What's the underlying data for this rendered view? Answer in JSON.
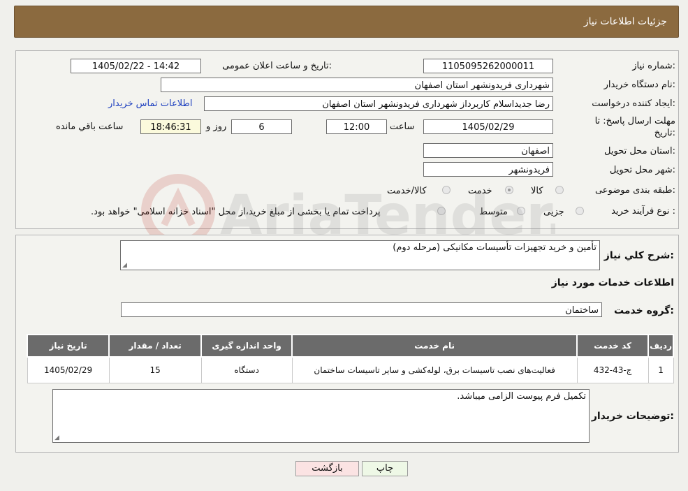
{
  "header": {
    "title": "جزئیات اطلاعات نیاز"
  },
  "fields": {
    "need_number": {
      "label": "شماره نیاز:",
      "value": "1105095262000011"
    },
    "announce": {
      "label": "تاریخ و ساعت اعلان عمومی:",
      "value": "1405/02/22 - 14:42"
    },
    "buyer_org": {
      "label": "نام دستگاه خریدار:",
      "value": "شهرداری فریدونشهر استان اصفهان"
    },
    "requester": {
      "label": "ایجاد کننده درخواست:",
      "value": "رضا جدیداسلام کاربرداز شهرداری فریدونشهر استان اصفهان",
      "contact_link": "اطلاعات تماس خریدار"
    },
    "deadline": {
      "label_line1": "مهلت ارسال پاسخ: تا",
      "label_line2": "تاریخ:",
      "date": "1405/02/29",
      "time_label": "ساعت",
      "time": "12:00",
      "days": "6",
      "days_label": "روز و",
      "remaining": "18:46:31",
      "remaining_label": "ساعت باقي مانده"
    },
    "province": {
      "label": "استان محل تحویل:",
      "value": "اصفهان"
    },
    "city": {
      "label": "شهر محل تحویل:",
      "value": "فریدونشهر"
    },
    "category": {
      "label": "طبقه بندی موضوعی:",
      "options": [
        "کالا",
        "خدمت",
        "کالا/خدمت"
      ],
      "selected": "خدمت"
    },
    "process": {
      "label": "نوع فرآیند خرید :",
      "options": [
        "جزیی",
        "متوسط"
      ],
      "note": "پرداخت تمام یا بخشی از مبلغ خرید،از محل \"اسناد خزانه اسلامی\" خواهد بود."
    }
  },
  "summary": {
    "label": "شرح کلي نیاز:",
    "value": "تأمین و خرید تجهیزات تأسیسات مکانیکی (مرحله دوم)"
  },
  "services": {
    "section_title": "اطلاعات خدمات مورد نیاز",
    "group_label": "گروه خدمت:",
    "group_value": "ساختمان",
    "columns": [
      "ردیف",
      "کد خدمت",
      "نام خدمت",
      "واحد اندازه گیری",
      "تعداد / مقدار",
      "تاریخ نیاز"
    ],
    "rows": [
      [
        "1",
        "ج-43-432",
        "فعالیت‌های نصب تاسیسات برق، لوله‌کشی و سایر تاسیسات ساختمان",
        "دستگاه",
        "15",
        "1405/02/29"
      ]
    ]
  },
  "buyer_notes": {
    "label": "توضیحات خریدار:",
    "value": "تکمیل فرم پیوست الزامی میباشد."
  },
  "buttons": {
    "print": "چاپ",
    "back": "بازگشت"
  },
  "watermark": {
    "text": "AriaTender.neT"
  },
  "colors": {
    "header_bg": "#8b6a3f",
    "table_header_bg": "#6b6b6b",
    "link": "#1d3fbf",
    "back_button_bg": "#fbe3e3",
    "print_button_bg": "#eef8e6"
  }
}
